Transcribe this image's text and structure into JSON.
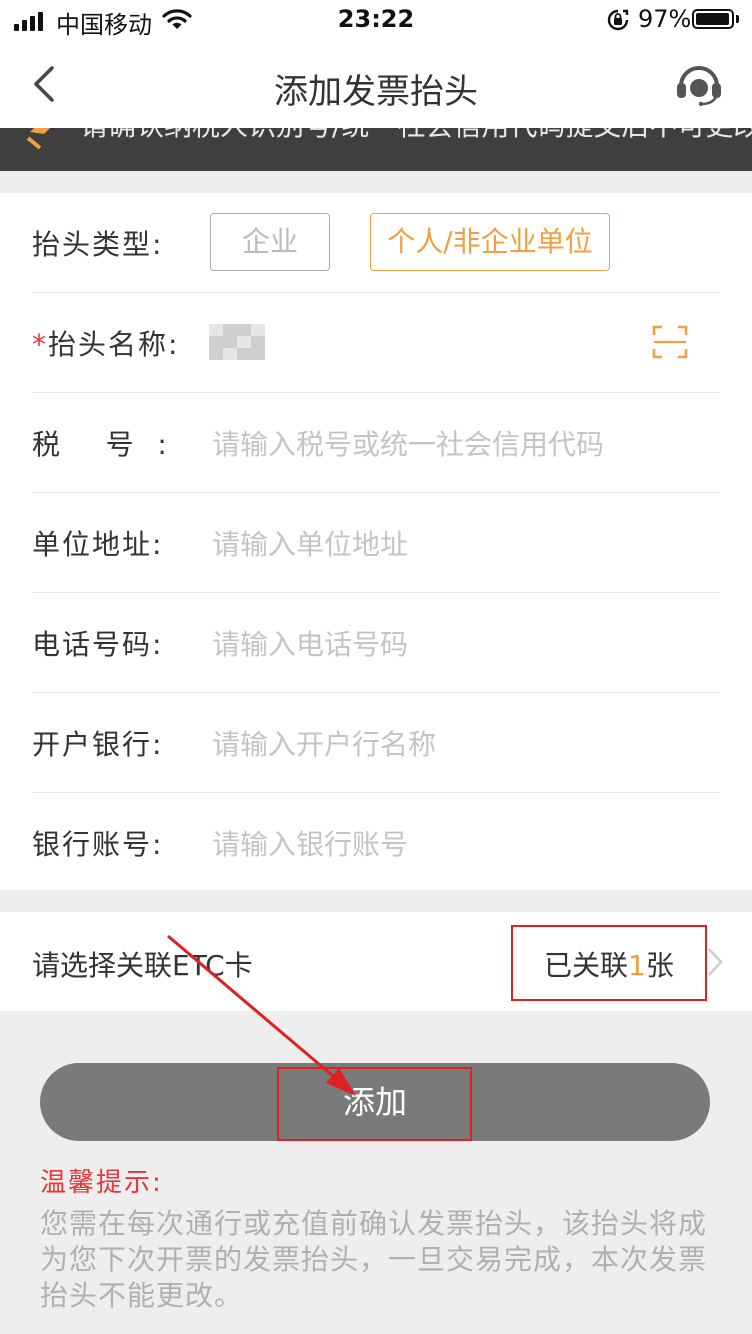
{
  "status_bar": {
    "carrier": "中国移动",
    "time": "23:22",
    "battery_percent": "97%",
    "battery_level": 0.97
  },
  "nav": {
    "title": "添加发票抬头",
    "back_icon": "chevron-left-icon",
    "support_icon": "headset-icon"
  },
  "notice": {
    "text": "请确认纳税人识别号/统一社会信用代码提交后不可更改。"
  },
  "form": {
    "header_type": {
      "label": "抬头类型:",
      "options": [
        "企业",
        "个人/非企业单位"
      ],
      "selected": "个人/非企业单位"
    },
    "header_name": {
      "required_mark": "*",
      "label": "抬头名称:"
    },
    "tax_number": {
      "label": "税    号  :",
      "placeholder": "请输入税号或统一社会信用代码"
    },
    "address": {
      "label": "单位地址:",
      "placeholder": "请输入单位地址"
    },
    "phone": {
      "label": "电话号码:",
      "placeholder": "请输入电话号码"
    },
    "bank": {
      "label": "开户银行:",
      "placeholder": "请输入开户行名称"
    },
    "account": {
      "label": "银行账号:",
      "placeholder": "请输入银行账号"
    }
  },
  "etc": {
    "label": "请选择关联ETC卡",
    "value_prefix": "已关联",
    "count": "1",
    "value_suffix": "张"
  },
  "add_button": {
    "label": "添加"
  },
  "tips": {
    "title": "温馨提示:",
    "body": "您需在每次通行或充值前确认发票抬头，该抬头将成为您下次开票的发票抬头，一旦交易完成，本次发票抬头不能更改。"
  },
  "colors": {
    "accent": "#f0a040",
    "required": "#e5363a",
    "annotation": "#e02020",
    "button": "#7a7a7a"
  }
}
